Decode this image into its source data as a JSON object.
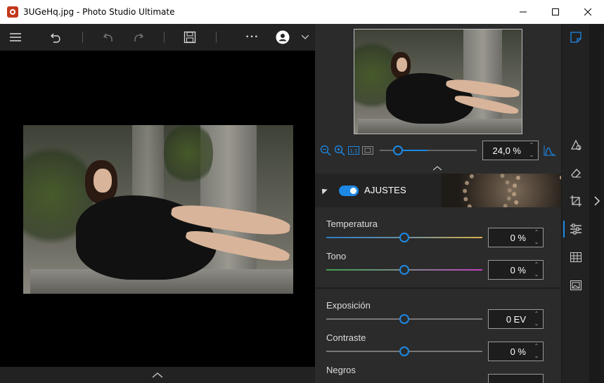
{
  "window": {
    "title": "3UGeHq.jpg - Photo Studio Ultimate",
    "icons": [
      "minimize-icon",
      "maximize-icon",
      "close-icon"
    ]
  },
  "toolbar": {
    "icons": [
      "menu-icon",
      "revert-icon",
      "undo-icon",
      "redo-icon",
      "save-icon",
      "more-icon",
      "account-icon",
      "chevron-down-icon"
    ],
    "more_label": "···"
  },
  "navigator": {
    "zoom_value": "24,0 %",
    "zoom_level": 0.24,
    "icons": [
      "zoom-out-icon",
      "zoom-in-icon",
      "actual-size-icon",
      "fit-screen-icon",
      "histogram-icon",
      "spin-up-icon",
      "spin-down-icon",
      "collapse-up-icon"
    ]
  },
  "adjustments": {
    "section_title": "AJUSTES",
    "enabled": true,
    "groups": [
      {
        "items": [
          {
            "label": "Temperatura",
            "value": "0 %",
            "level": 0.5
          },
          {
            "label": "Tono",
            "value": "0 %",
            "level": 0.5
          }
        ]
      },
      {
        "items": [
          {
            "label": "Exposición",
            "value": "0 EV",
            "level": 0.5
          },
          {
            "label": "Contraste",
            "value": "0 %",
            "level": 0.5
          },
          {
            "label": "Negros",
            "value": "",
            "level": 0.5
          }
        ]
      }
    ]
  },
  "side_tools": {
    "icons": [
      "edit-panel-icon",
      "retouch-icon",
      "eraser-icon",
      "crop-icon",
      "adjustments-icon",
      "texture-icon",
      "image-icon"
    ],
    "active": "adjustments-icon"
  },
  "colors": {
    "accent": "#1e88e5",
    "panel": "#2b2b2b",
    "toolbar": "#222222"
  }
}
